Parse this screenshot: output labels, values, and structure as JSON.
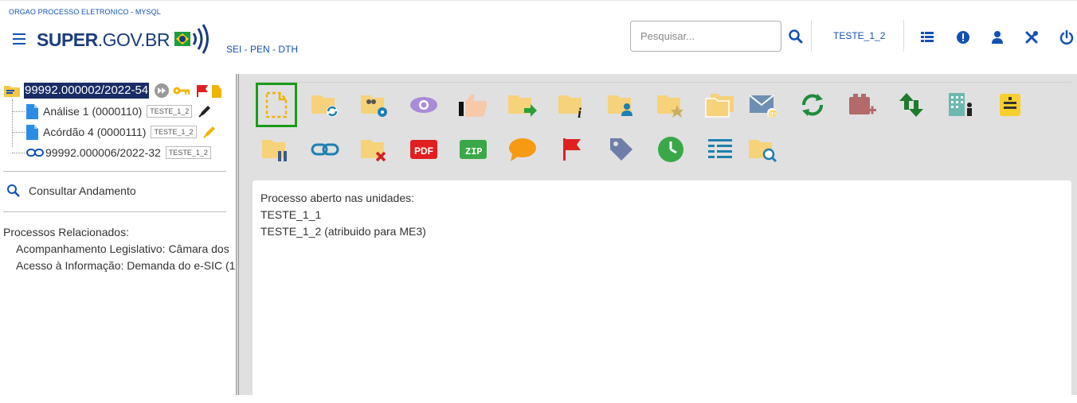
{
  "header": {
    "org": "ORGAO PROCESSO ELETRONICO - MYSQL",
    "logo_bold": "SUPER",
    "logo_rest": ".GOV.BR",
    "system": "SEI - PEN - DTH",
    "search_placeholder": "Pesquisar...",
    "unit": "TESTE_1_2",
    "accent": "#1351b4"
  },
  "tree": {
    "root": "99992.000002/2022-54",
    "items": [
      {
        "label": "Análise 1 (0000110)",
        "tag": "TESTE_1_2"
      },
      {
        "label": "Acórdão 4 (0000111)",
        "tag": "TESTE_1_2"
      },
      {
        "label": "99992.000006/2022-32",
        "tag": "TESTE_1_2"
      }
    ]
  },
  "sidebar": {
    "consultar": "Consultar Andamento",
    "related_title": "Processos Relacionados:",
    "related": [
      "Acompanhamento Legislativo: Câmara dos",
      "Acesso à Informação: Demanda do e-SIC (1"
    ]
  },
  "toolbar_icons": [
    "new-document-icon",
    "relate-process-icon",
    "manage-users-icon",
    "view-icon",
    "vote-icon",
    "send-process-icon",
    "process-info-icon",
    "assign-user-icon",
    "follow-up-icon",
    "open-folders-icon",
    "email-icon",
    "refresh-icon",
    "block-add-icon",
    "transfer-icon",
    "organization-icon",
    "note-icon",
    "suspend-icon",
    "link-icon",
    "close-process-icon",
    "pdf-icon",
    "zip-icon",
    "comment-icon",
    "flag-icon",
    "tag-icon",
    "clock-icon",
    "list-icon",
    "search-folder-icon"
  ],
  "content": {
    "heading": "Processo aberto nas unidades:",
    "units": [
      "TESTE_1_1",
      "TESTE_1_2 (atribuido para ME3)"
    ]
  }
}
